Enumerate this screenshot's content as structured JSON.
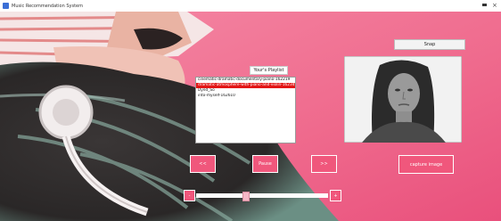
{
  "window": {
    "title": "Music Recommendation System",
    "minimize_glyph": "⬤",
    "close_glyph": "×"
  },
  "playlist": {
    "title": "Your's Playlist",
    "items": [
      {
        "label": "cinematic-dramatic-documentary-piano-162219",
        "selected": false
      },
      {
        "label": "dramatic-atmosphere-with-piano-and-violin-162349",
        "selected": true
      },
      {
        "label": "Dyed_So",
        "selected": false
      },
      {
        "label": "into-myself-162610",
        "selected": false
      }
    ]
  },
  "snap_button": {
    "label": "Snap"
  },
  "controls": {
    "prev_label": "<<",
    "pause_label": "Pause",
    "next_label": ">>",
    "capture_label": "capture image"
  },
  "volume": {
    "minus_label": "-",
    "plus_label": "+",
    "level": 0.38
  },
  "colors": {
    "accent": "#f0577c",
    "selection": "#e21616",
    "background": "#f06a8e"
  }
}
